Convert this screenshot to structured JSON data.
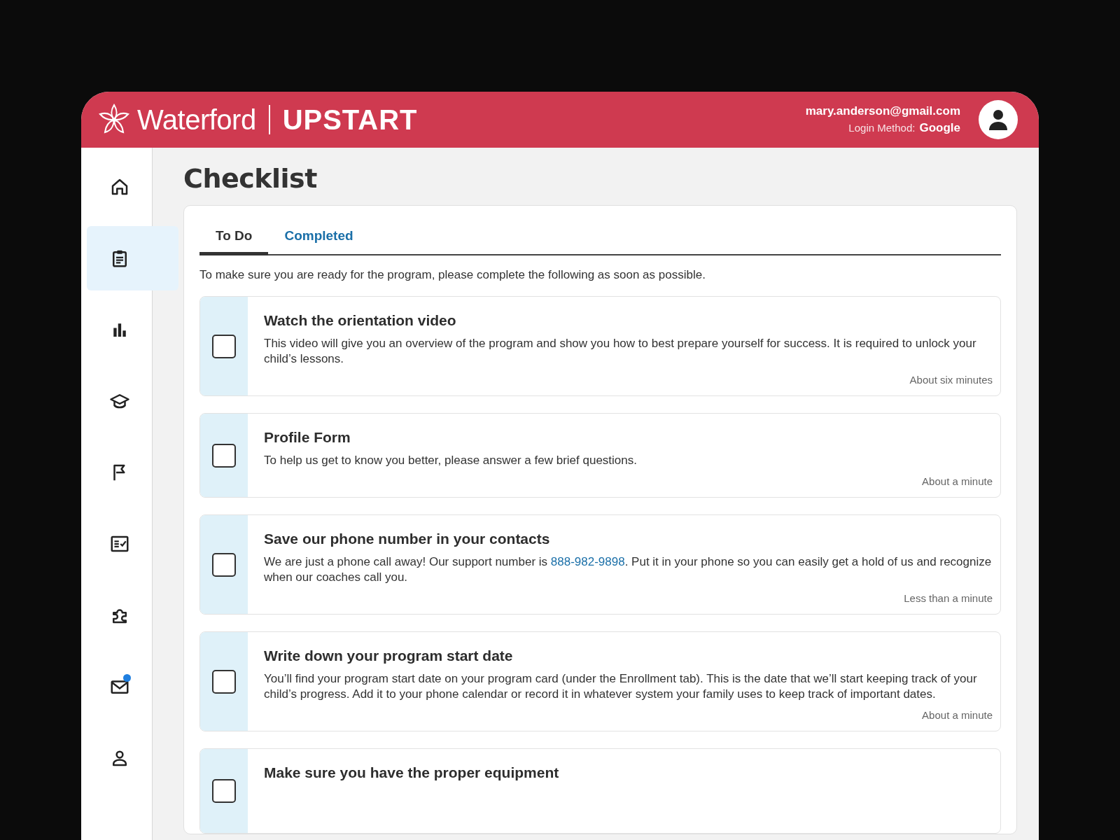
{
  "header": {
    "brand": "Waterford",
    "product": "UPSTART",
    "email": "mary.anderson@gmail.com",
    "login_label": "Login Method:",
    "login_value": "Google"
  },
  "sidebar": {
    "items": [
      {
        "kind": "home",
        "selected": false,
        "unread": false
      },
      {
        "kind": "clipboard",
        "selected": true,
        "unread": false
      },
      {
        "kind": "chart",
        "selected": false,
        "unread": false
      },
      {
        "kind": "graduation",
        "selected": false,
        "unread": false
      },
      {
        "kind": "flag",
        "selected": false,
        "unread": false
      },
      {
        "kind": "checklist",
        "selected": false,
        "unread": false
      },
      {
        "kind": "puzzle",
        "selected": false,
        "unread": false
      },
      {
        "kind": "mail",
        "selected": false,
        "unread": true
      },
      {
        "kind": "person",
        "selected": false,
        "unread": false
      }
    ]
  },
  "page": {
    "title": "Checklist"
  },
  "tabs": [
    {
      "label": "To Do",
      "selected": true
    },
    {
      "label": "Completed",
      "selected": false
    }
  ],
  "intro": "To make sure you are ready for the program, please complete the following as soon as possible.",
  "tasks": [
    {
      "title": "Watch the orientation video",
      "checked": false,
      "description": [
        {
          "kind": "text",
          "text": "This video will give you an overview of the program and show you how to best prepare yourself for success. It is required to unlock your child’s lessons."
        }
      ],
      "duration": "About six minutes"
    },
    {
      "title": "Profile Form",
      "checked": false,
      "description": [
        {
          "kind": "text",
          "text": "To help us get to know you better, please answer a few brief questions."
        }
      ],
      "duration": "About a minute"
    },
    {
      "title": "Save our phone number in your contacts",
      "checked": false,
      "description": [
        {
          "kind": "text",
          "text": "We are just a phone call away! Our support number is "
        },
        {
          "kind": "link",
          "text": "888-982-9898"
        },
        {
          "kind": "text",
          "text": ". Put it in your phone so you can easily get a hold of us and recognize when our coaches call you."
        }
      ],
      "duration": "Less than a minute"
    },
    {
      "title": "Write down your program start date",
      "checked": false,
      "description": [
        {
          "kind": "text",
          "text": "You’ll find your program start date on your program card (under the Enrollment tab). This is the date that we’ll start keeping track of your child’s progress. Add it to your phone calendar or record it in whatever system your family uses to keep track of important dates."
        }
      ],
      "duration": "About a minute"
    },
    {
      "title": "Make sure you have the proper equipment",
      "checked": false
    }
  ]
}
